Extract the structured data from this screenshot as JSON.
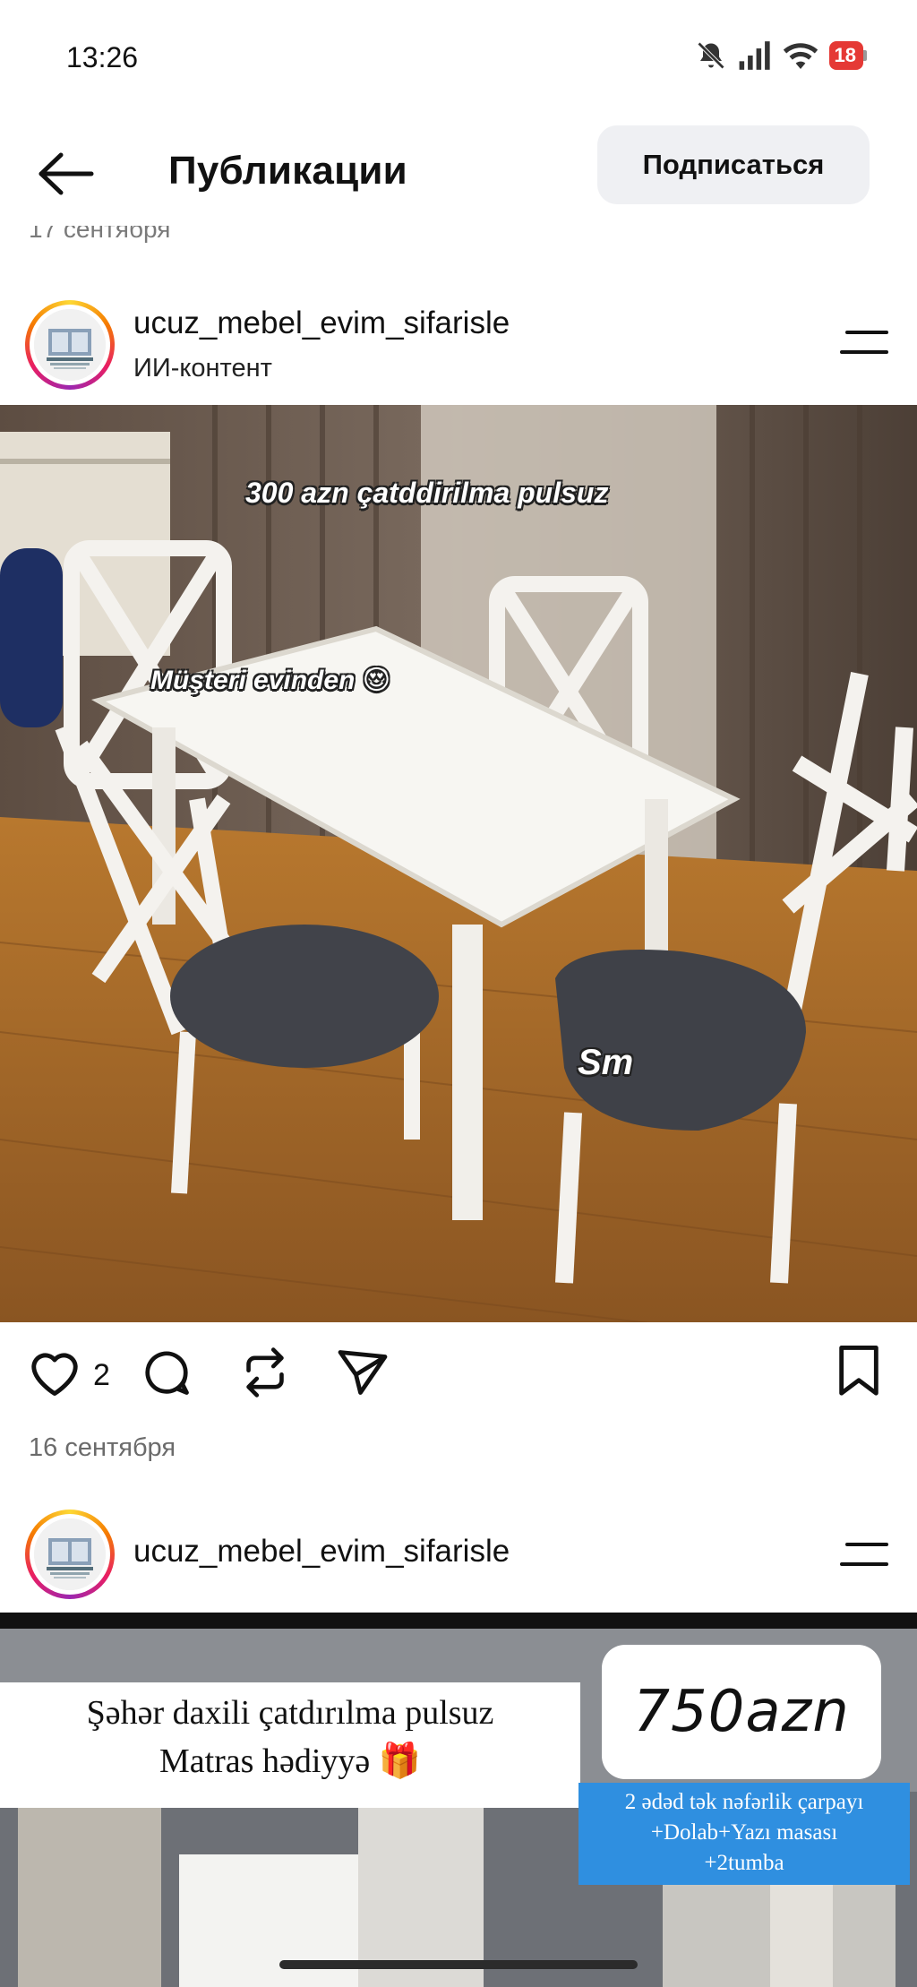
{
  "status_bar": {
    "time": "13:26",
    "battery": "18",
    "icons": [
      "bell-off-icon",
      "signal-icon",
      "wifi-icon",
      "battery-icon"
    ]
  },
  "header": {
    "back_icon": "arrow-left-icon",
    "title": "Публикации",
    "subscribe_label": "Подписаться"
  },
  "previous_post_date": "17 сентября",
  "posts": [
    {
      "username": "ucuz_mebel_evim_sifarisle",
      "ai_label": "ИИ-контент",
      "menu_icon": "more-icon",
      "overlay_lines": [
        "300 azn çatddirilma pulsuz",
        "Müşteri evinden 😍",
        "Sm"
      ],
      "likes": "2",
      "date": "16 сентября",
      "action_icons": [
        "heart-icon",
        "comment-icon",
        "repost-icon",
        "share-icon",
        "bookmark-icon"
      ]
    },
    {
      "username": "ucuz_mebel_evim_sifarisle",
      "menu_icon": "more-icon",
      "banner_line1": "Şəhər daxili çatdırılma pulsuz",
      "banner_line2": "Matras hədiyyə 🎁",
      "price": "750azn",
      "blue_box_line1": "2 ədəd tək nəfərlik çarpayı",
      "blue_box_line2": "+Dolab+Yazı masası",
      "blue_box_line3": "+2tumba"
    }
  ],
  "colors": {
    "subscribe_bg": "#eff0f3",
    "battery": "#e53935",
    "muted_text": "#6b6b6b",
    "blue_box": "#2f8fe0"
  }
}
